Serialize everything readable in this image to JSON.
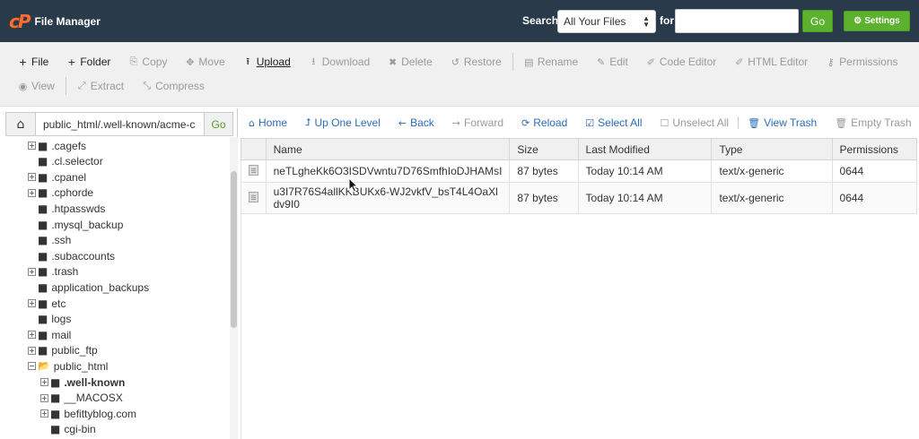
{
  "header": {
    "brand_logo": "cP",
    "brand_title": "File Manager",
    "search_label": "Search",
    "search_select": "All Your Files",
    "for_label": "for",
    "search_value": "",
    "go_label": "Go",
    "settings_label": "Settings",
    "colors": {
      "bar": "#293a4a",
      "accent": "#ff6c2c",
      "button": "#5cb12f"
    }
  },
  "toolbar": {
    "row1": [
      {
        "icon": "plus-icon",
        "glyph": "+",
        "label": "File",
        "state": "active"
      },
      {
        "icon": "plus-icon",
        "glyph": "+",
        "label": "Folder",
        "state": "active"
      },
      {
        "icon": "copy-icon",
        "glyph": "⎘",
        "label": "Copy",
        "state": "disabled"
      },
      {
        "icon": "move-icon",
        "glyph": "✥",
        "label": "Move",
        "state": "disabled"
      },
      {
        "icon": "upload-icon",
        "glyph": "⭱",
        "label": "Upload",
        "state": "active"
      },
      {
        "icon": "download-icon",
        "glyph": "⭳",
        "label": "Download",
        "state": "disabled"
      },
      {
        "icon": "delete-icon",
        "glyph": "✖",
        "label": "Delete",
        "state": "disabled"
      },
      {
        "icon": "restore-icon",
        "glyph": "↺",
        "label": "Restore",
        "state": "disabled"
      },
      {
        "icon": "rename-icon",
        "glyph": "▤",
        "label": "Rename",
        "state": "disabled"
      },
      {
        "icon": "edit-icon",
        "glyph": "✎",
        "label": "Edit",
        "state": "disabled"
      },
      {
        "icon": "code-editor-icon",
        "glyph": "✐",
        "label": "Code Editor",
        "state": "disabled"
      },
      {
        "icon": "html-editor-icon",
        "glyph": "✐",
        "label": "HTML Editor",
        "state": "disabled"
      },
      {
        "icon": "key-icon",
        "glyph": "⚷",
        "label": "Permissions",
        "state": "disabled"
      }
    ],
    "row2": [
      {
        "icon": "eye-icon",
        "glyph": "◉",
        "label": "View",
        "state": "disabled"
      },
      {
        "icon": "extract-icon",
        "glyph": "⤢",
        "label": "Extract",
        "state": "disabled"
      },
      {
        "icon": "compress-icon",
        "glyph": "⤡",
        "label": "Compress",
        "state": "disabled"
      }
    ]
  },
  "path_bar": {
    "path_value": "public_html/.well-known/acme-c",
    "go_label": "Go"
  },
  "tree": [
    {
      "label": ".cagefs",
      "level": 0,
      "expander": "+",
      "bold": false
    },
    {
      "label": ".cl.selector",
      "level": 0,
      "expander": "",
      "bold": false
    },
    {
      "label": ".cpanel",
      "level": 0,
      "expander": "+",
      "bold": false
    },
    {
      "label": ".cphorde",
      "level": 0,
      "expander": "+",
      "bold": false
    },
    {
      "label": ".htpasswds",
      "level": 0,
      "expander": "",
      "bold": false
    },
    {
      "label": ".mysql_backup",
      "level": 0,
      "expander": "",
      "bold": false
    },
    {
      "label": ".ssh",
      "level": 0,
      "expander": "",
      "bold": false
    },
    {
      "label": ".subaccounts",
      "level": 0,
      "expander": "",
      "bold": false
    },
    {
      "label": ".trash",
      "level": 0,
      "expander": "+",
      "bold": false
    },
    {
      "label": "application_backups",
      "level": 0,
      "expander": "",
      "bold": false
    },
    {
      "label": "etc",
      "level": 0,
      "expander": "+",
      "bold": false
    },
    {
      "label": "logs",
      "level": 0,
      "expander": "",
      "bold": false
    },
    {
      "label": "mail",
      "level": 0,
      "expander": "+",
      "bold": false
    },
    {
      "label": "public_ftp",
      "level": 0,
      "expander": "+",
      "bold": false
    },
    {
      "label": "public_html",
      "level": 0,
      "expander": "−",
      "bold": false,
      "open": true
    },
    {
      "label": ".well-known",
      "level": 1,
      "expander": "+",
      "bold": true
    },
    {
      "label": "__MACOSX",
      "level": 1,
      "expander": "+",
      "bold": false
    },
    {
      "label": "befittyblog.com",
      "level": 1,
      "expander": "+",
      "bold": false
    },
    {
      "label": "cgi-bin",
      "level": 1,
      "expander": "",
      "bold": false
    }
  ],
  "nav": [
    {
      "icon": "home-icon",
      "glyph": "⌂",
      "label": "Home",
      "style": "blue",
      "name": "nav-home-button"
    },
    {
      "icon": "level-up-icon",
      "glyph": "⮥",
      "label": "Up One Level",
      "style": "blue",
      "name": "nav-up-one-level-button"
    },
    {
      "icon": "arrow-left-icon",
      "glyph": "←",
      "label": "Back",
      "style": "blue",
      "name": "nav-back-button"
    },
    {
      "icon": "arrow-right-icon",
      "glyph": "→",
      "label": "Forward",
      "style": "gray",
      "name": "nav-forward-button"
    },
    {
      "icon": "reload-icon",
      "glyph": "⟳",
      "label": "Reload",
      "style": "blue",
      "name": "nav-reload-button"
    },
    {
      "icon": "checkbox-checked-icon",
      "glyph": "☑",
      "label": "Select All",
      "style": "blue",
      "name": "nav-select-all-button"
    },
    {
      "icon": "checkbox-empty-icon",
      "glyph": "☐",
      "label": "Unselect All",
      "style": "gray",
      "name": "nav-unselect-all-button"
    },
    {
      "icon": "trash-icon",
      "glyph": "🗑",
      "label": "View Trash",
      "style": "blue",
      "name": "nav-view-trash-button"
    },
    {
      "icon": "trash-icon",
      "glyph": "🗑",
      "label": "Empty Trash",
      "style": "gray",
      "name": "nav-empty-trash-button"
    }
  ],
  "table": {
    "columns": [
      "Name",
      "Size",
      "Last Modified",
      "Type",
      "Permissions"
    ],
    "rows": [
      {
        "name": "neTLgheKk6O3ISDVwntu7D76SmfhIoDJHAMsI",
        "size": "87 bytes",
        "modified": "Today 10:14 AM",
        "type": "text/x-generic",
        "perms": "0644"
      },
      {
        "name": "u3I7R76S4allKKBUKx6-WJ2vkfV_bsT4L4OaXldv9I0",
        "size": "87 bytes",
        "modified": "Today 10:14 AM",
        "type": "text/x-generic",
        "perms": "0644"
      }
    ]
  }
}
